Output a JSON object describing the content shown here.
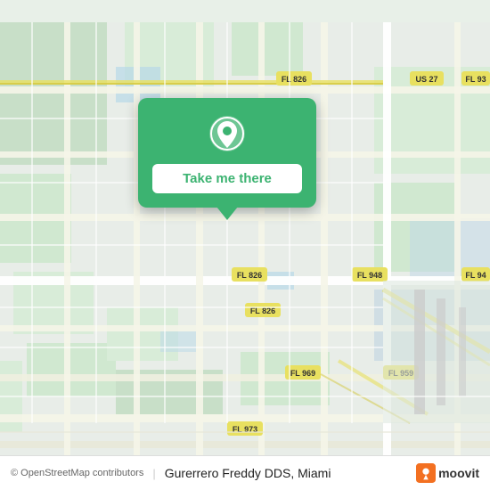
{
  "map": {
    "alt": "Map of Miami area showing streets and highways",
    "attribution": "© OpenStreetMap contributors",
    "place_name": "Gurerrero Freddy DDS, Miami"
  },
  "card": {
    "button_label": "Take me there"
  },
  "branding": {
    "moovit_label": "moovit"
  }
}
